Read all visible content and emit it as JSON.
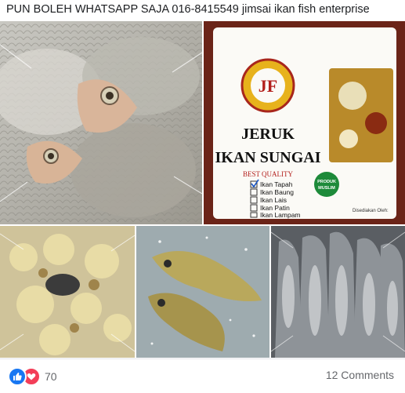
{
  "post": {
    "text": "PUN BOLEH WHATSAPP SAJA 016-8415549 jimsai ikan fish enterprise"
  },
  "product_label": {
    "logo_text": "JF",
    "title_line1": "JERUK",
    "title_line2": "IKAN SUNGAI",
    "subtitle": "BEST QUALITY",
    "checklist": [
      {
        "label": "Ikan Tapah",
        "checked": true
      },
      {
        "label": "Ikan Baung",
        "checked": false
      },
      {
        "label": "Ikan Lais",
        "checked": false
      },
      {
        "label": "Ikan Patin",
        "checked": false
      },
      {
        "label": "Ikan Lampam",
        "checked": false
      }
    ],
    "badge_line1": "PRODUK",
    "badge_line2": "MUSLIM",
    "footer_text": "Disediakan Oleh:"
  },
  "footer": {
    "reaction_count": "70",
    "comments_label": "12 Comments"
  },
  "colors": {
    "like": "#1877f2",
    "love": "#f33e58",
    "muted_text": "#65676b",
    "label_red": "#b3201d",
    "badge_green": "#1d8a3a"
  },
  "icons": {
    "like": "thumbs-up-icon",
    "love": "heart-icon"
  }
}
